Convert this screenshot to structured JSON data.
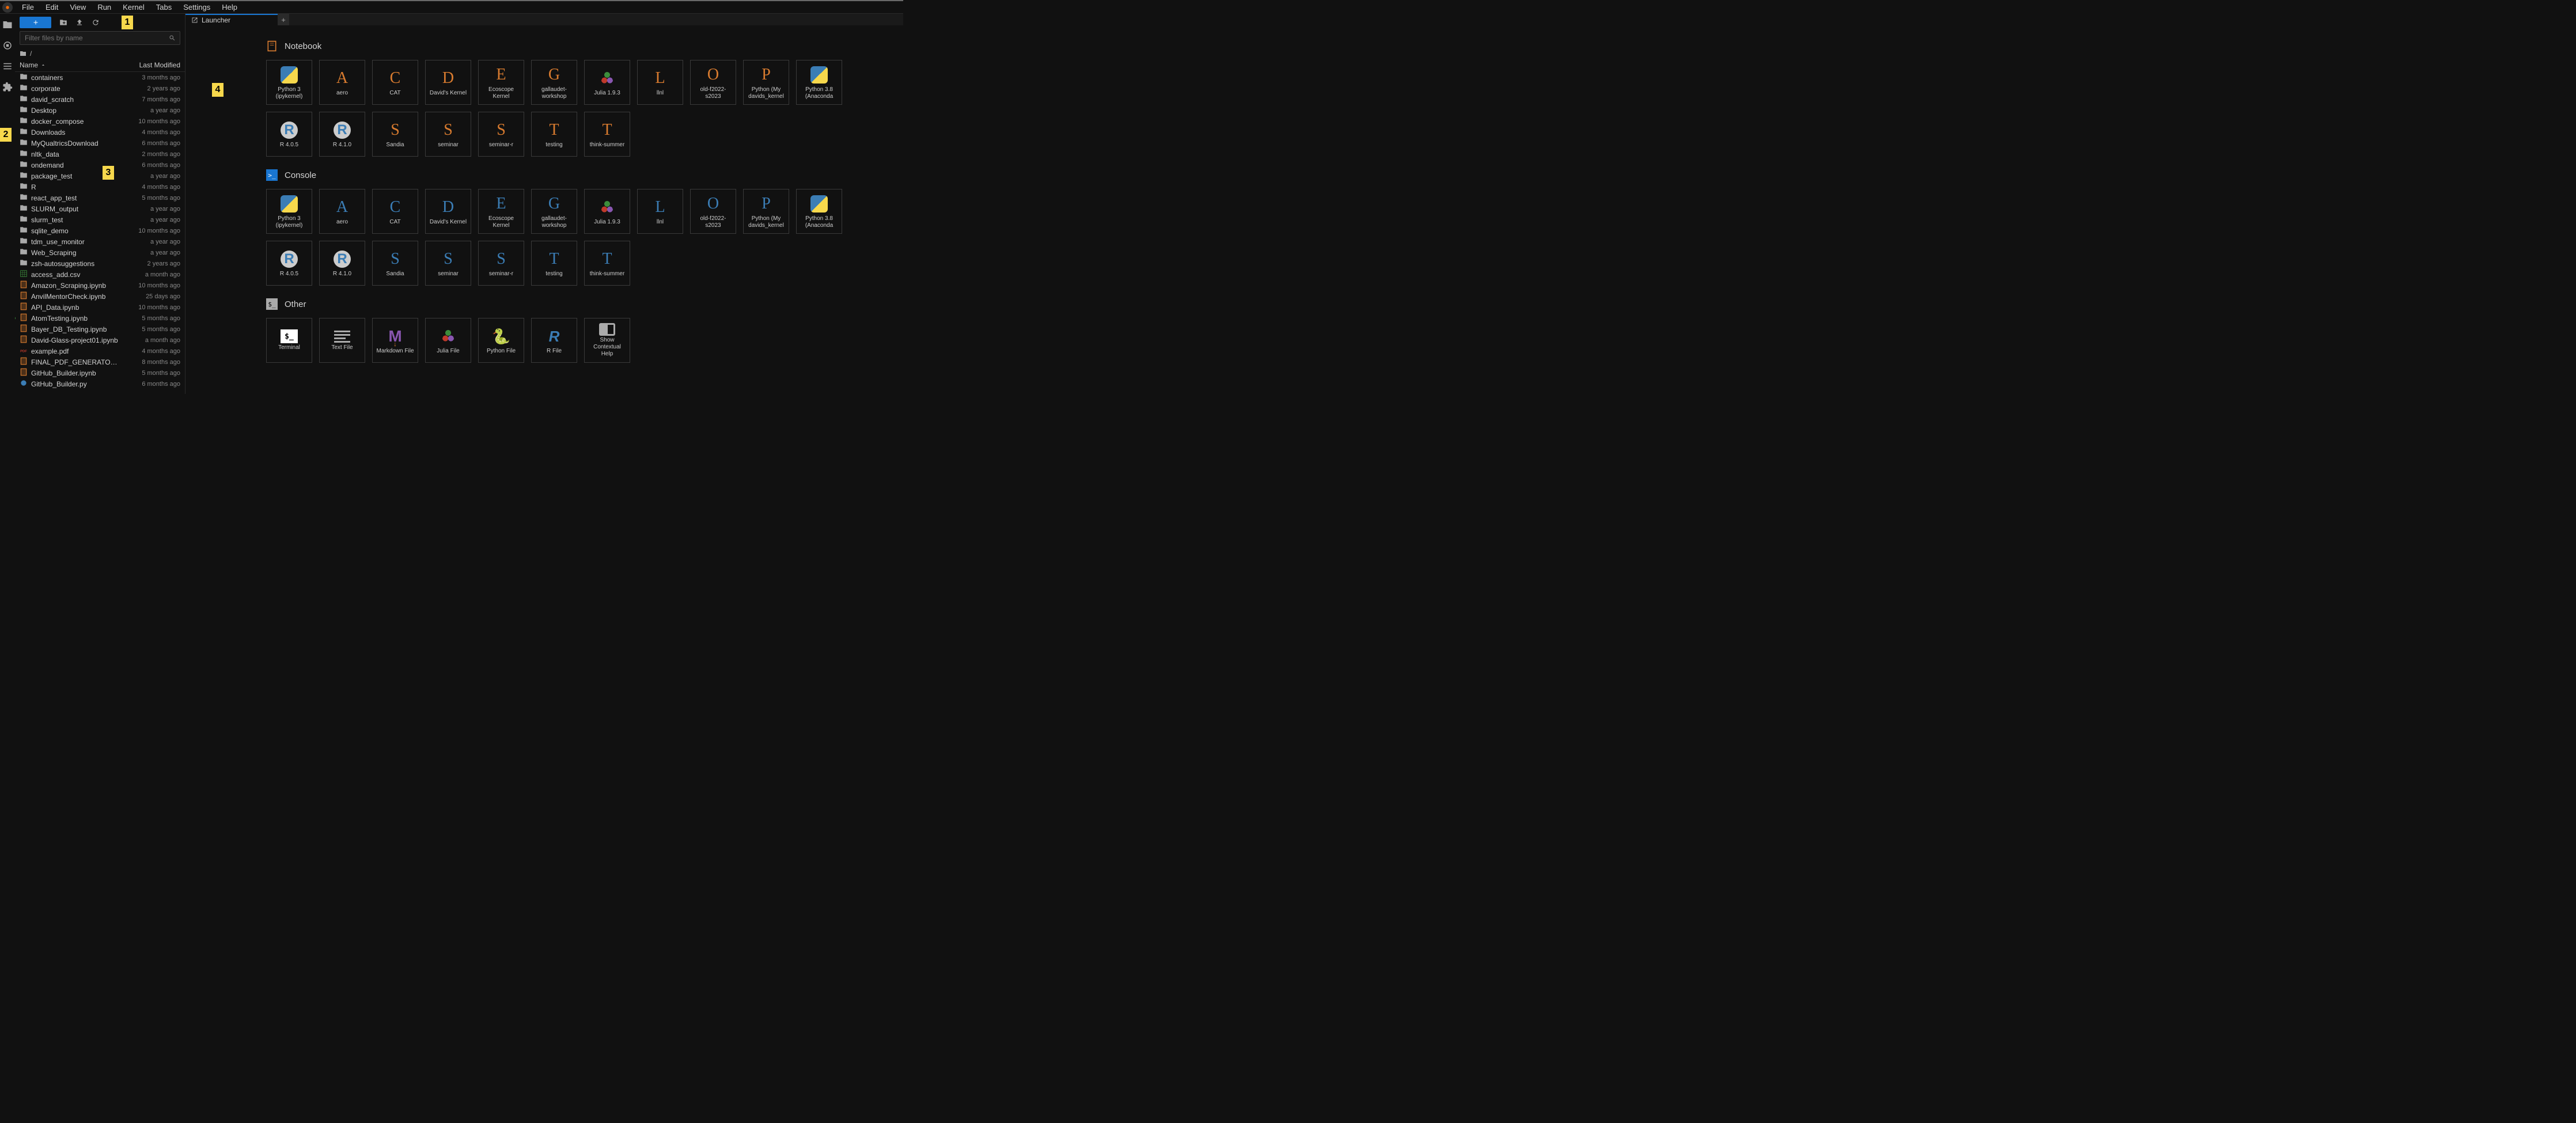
{
  "menu": [
    "File",
    "Edit",
    "View",
    "Run",
    "Kernel",
    "Tabs",
    "Settings",
    "Help"
  ],
  "filebrowser": {
    "filter_placeholder": "Filter files by name",
    "breadcrumb": "/",
    "columns": {
      "name": "Name",
      "modified": "Last Modified"
    },
    "items": [
      {
        "name": "containers",
        "type": "folder",
        "modified": "3 months ago"
      },
      {
        "name": "corporate",
        "type": "folder",
        "modified": "2 years ago"
      },
      {
        "name": "david_scratch",
        "type": "folder",
        "modified": "7 months ago"
      },
      {
        "name": "Desktop",
        "type": "folder",
        "modified": "a year ago"
      },
      {
        "name": "docker_compose",
        "type": "folder",
        "modified": "10 months ago"
      },
      {
        "name": "Downloads",
        "type": "folder",
        "modified": "4 months ago"
      },
      {
        "name": "MyQualtricsDownload",
        "type": "folder",
        "modified": "6 months ago"
      },
      {
        "name": "nltk_data",
        "type": "folder",
        "modified": "2 months ago"
      },
      {
        "name": "ondemand",
        "type": "folder",
        "modified": "6 months ago"
      },
      {
        "name": "package_test",
        "type": "folder",
        "modified": "a year ago"
      },
      {
        "name": "R",
        "type": "folder",
        "modified": "4 months ago"
      },
      {
        "name": "react_app_test",
        "type": "folder",
        "modified": "5 months ago"
      },
      {
        "name": "SLURM_output",
        "type": "folder",
        "modified": "a year ago"
      },
      {
        "name": "slurm_test",
        "type": "folder",
        "modified": "a year ago"
      },
      {
        "name": "sqlite_demo",
        "type": "folder",
        "modified": "10 months ago"
      },
      {
        "name": "tdm_use_monitor",
        "type": "folder",
        "modified": "a year ago"
      },
      {
        "name": "Web_Scraping",
        "type": "folder",
        "modified": "a year ago"
      },
      {
        "name": "zsh-autosuggestions",
        "type": "folder",
        "modified": "2 years ago"
      },
      {
        "name": "access_add.csv",
        "type": "csv",
        "modified": "a month ago"
      },
      {
        "name": "Amazon_Scraping.ipynb",
        "type": "notebook",
        "modified": "10 months ago"
      },
      {
        "name": "AnvilMentorCheck.ipynb",
        "type": "notebook",
        "modified": "25 days ago"
      },
      {
        "name": "API_Data.ipynb",
        "type": "notebook",
        "modified": "10 months ago"
      },
      {
        "name": "AtomTesting.ipynb",
        "type": "notebook",
        "modified": "5 months ago",
        "running": true
      },
      {
        "name": "Bayer_DB_Testing.ipynb",
        "type": "notebook",
        "modified": "5 months ago"
      },
      {
        "name": "David-Glass-project01.ipynb",
        "type": "notebook",
        "modified": "a month ago"
      },
      {
        "name": "example.pdf",
        "type": "pdf",
        "modified": "4 months ago"
      },
      {
        "name": "FINAL_PDF_GENERATOR.ipynb",
        "type": "notebook",
        "modified": "8 months ago"
      },
      {
        "name": "GitHub_Builder.ipynb",
        "type": "notebook",
        "modified": "5 months ago"
      },
      {
        "name": "GitHub_Builder.py",
        "type": "python",
        "modified": "6 months ago"
      }
    ]
  },
  "tab": {
    "label": "Launcher"
  },
  "launcher": {
    "sections": [
      {
        "title": "Notebook",
        "icon": "notebook",
        "cards": [
          {
            "label": "Python 3 (ipykernel)",
            "icon": "python"
          },
          {
            "label": "aero",
            "icon": "letter",
            "letter": "A",
            "tone": "orange"
          },
          {
            "label": "CAT",
            "icon": "letter",
            "letter": "C",
            "tone": "orange"
          },
          {
            "label": "David's Kernel",
            "icon": "letter",
            "letter": "D",
            "tone": "orange"
          },
          {
            "label": "Ecoscope Kernel",
            "icon": "letter",
            "letter": "E",
            "tone": "orange"
          },
          {
            "label": "gallaudet-workshop",
            "icon": "letter",
            "letter": "G",
            "tone": "orange"
          },
          {
            "label": "Julia 1.9.3",
            "icon": "julia"
          },
          {
            "label": "llnl",
            "icon": "letter",
            "letter": "L",
            "tone": "orange"
          },
          {
            "label": "old-f2022-s2023",
            "icon": "letter",
            "letter": "O",
            "tone": "orange"
          },
          {
            "label": "Python (My davids_kernel",
            "icon": "letter",
            "letter": "P",
            "tone": "orange"
          },
          {
            "label": "Python 3.8 (Anaconda",
            "icon": "python"
          },
          {
            "label": "R 4.0.5",
            "icon": "r"
          },
          {
            "label": "R 4.1.0",
            "icon": "r"
          },
          {
            "label": "Sandia",
            "icon": "letter",
            "letter": "S",
            "tone": "orange"
          },
          {
            "label": "seminar",
            "icon": "letter",
            "letter": "S",
            "tone": "orange"
          },
          {
            "label": "seminar-r",
            "icon": "letter",
            "letter": "S",
            "tone": "orange"
          },
          {
            "label": "testing",
            "icon": "letter",
            "letter": "T",
            "tone": "orange"
          },
          {
            "label": "think-summer",
            "icon": "letter",
            "letter": "T",
            "tone": "orange"
          }
        ]
      },
      {
        "title": "Console",
        "icon": "console",
        "cards": [
          {
            "label": "Python 3 (ipykernel)",
            "icon": "python"
          },
          {
            "label": "aero",
            "icon": "letter",
            "letter": "A",
            "tone": "blue"
          },
          {
            "label": "CAT",
            "icon": "letter",
            "letter": "C",
            "tone": "blue"
          },
          {
            "label": "David's Kernel",
            "icon": "letter",
            "letter": "D",
            "tone": "blue"
          },
          {
            "label": "Ecoscope Kernel",
            "icon": "letter",
            "letter": "E",
            "tone": "blue"
          },
          {
            "label": "gallaudet-workshop",
            "icon": "letter",
            "letter": "G",
            "tone": "blue"
          },
          {
            "label": "Julia 1.9.3",
            "icon": "julia"
          },
          {
            "label": "llnl",
            "icon": "letter",
            "letter": "L",
            "tone": "blue"
          },
          {
            "label": "old-f2022-s2023",
            "icon": "letter",
            "letter": "O",
            "tone": "blue"
          },
          {
            "label": "Python (My davids_kernel",
            "icon": "letter",
            "letter": "P",
            "tone": "blue"
          },
          {
            "label": "Python 3.8 (Anaconda",
            "icon": "python"
          },
          {
            "label": "R 4.0.5",
            "icon": "r"
          },
          {
            "label": "R 4.1.0",
            "icon": "r"
          },
          {
            "label": "Sandia",
            "icon": "letter",
            "letter": "S",
            "tone": "blue"
          },
          {
            "label": "seminar",
            "icon": "letter",
            "letter": "S",
            "tone": "blue"
          },
          {
            "label": "seminar-r",
            "icon": "letter",
            "letter": "S",
            "tone": "blue"
          },
          {
            "label": "testing",
            "icon": "letter",
            "letter": "T",
            "tone": "blue"
          },
          {
            "label": "think-summer",
            "icon": "letter",
            "letter": "T",
            "tone": "blue"
          }
        ]
      },
      {
        "title": "Other",
        "icon": "other",
        "cards": [
          {
            "label": "Terminal",
            "icon": "terminal"
          },
          {
            "label": "Text File",
            "icon": "textfile"
          },
          {
            "label": "Markdown File",
            "icon": "markdown"
          },
          {
            "label": "Julia File",
            "icon": "julia"
          },
          {
            "label": "Python File",
            "icon": "pyfile"
          },
          {
            "label": "R File",
            "icon": "rfile"
          },
          {
            "label": "Show Contextual Help",
            "icon": "help"
          }
        ]
      }
    ]
  },
  "markers": [
    "1",
    "2",
    "3",
    "4"
  ]
}
